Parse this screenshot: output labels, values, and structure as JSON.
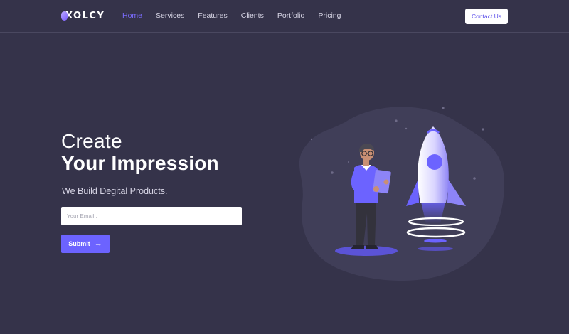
{
  "brand": {
    "logo_text": "XOLCY"
  },
  "nav": {
    "links": [
      {
        "label": "Home",
        "active": true
      },
      {
        "label": "Services",
        "active": false
      },
      {
        "label": "Features",
        "active": false
      },
      {
        "label": "Clients",
        "active": false
      },
      {
        "label": "Portfolio",
        "active": false
      },
      {
        "label": "Pricing",
        "active": false
      }
    ],
    "contact_label": "Contact Us"
  },
  "hero": {
    "title_line1": "Create",
    "title_line2": "Your Impression",
    "subtitle": "We Build Degital Products.",
    "email_placeholder": "Your Email..",
    "submit_label": "Submit",
    "submit_icon": "arrow-right-icon"
  },
  "colors": {
    "background": "#35334a",
    "accent": "#6c63ff",
    "active_link": "#7b6cff",
    "illustration_blob": "#403e58"
  }
}
